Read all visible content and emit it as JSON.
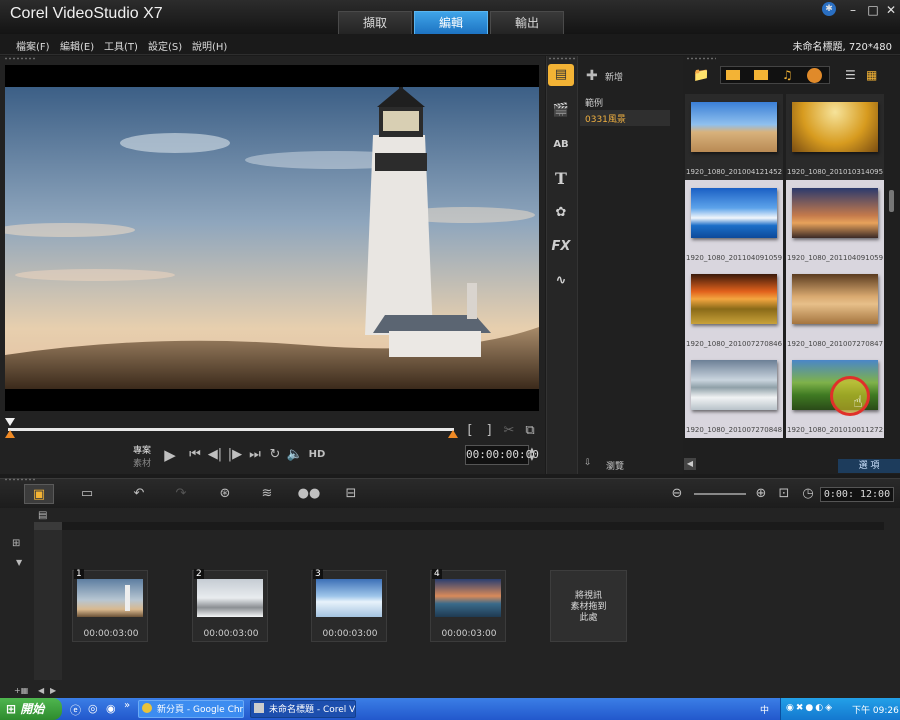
{
  "app": {
    "title": "Corel VideoStudio X7"
  },
  "workspace_tabs": [
    {
      "label": "擷取"
    },
    {
      "label": "編輯"
    },
    {
      "label": "輸出"
    }
  ],
  "menu": [
    "檔案(F)",
    "編輯(E)",
    "工具(T)",
    "設定(S)",
    "說明(H)"
  ],
  "project_info": "未命名標題, 720*480",
  "player": {
    "mode_labels": [
      "專案",
      "素材"
    ],
    "hd_label": "HD",
    "timecode": "00:00:00:00"
  },
  "library": {
    "add_label": "新增",
    "folders": [
      {
        "label": "範例"
      },
      {
        "label": "0331風景"
      }
    ],
    "browse_label": "瀏覽",
    "options_label": "選 項",
    "thumbnails": [
      {
        "caption": "1920_1080_20100412145258..."
      },
      {
        "caption": "1920_1080_20101031409515373..."
      },
      {
        "caption": "1920_1080_20110409105918299..."
      },
      {
        "caption": "1920_1080_20110409105919667..."
      },
      {
        "caption": "1920_1080_20100727084647113..."
      },
      {
        "caption": "1920_1080_20100727084736147..."
      },
      {
        "caption": "1920_1080_20100727084803177..."
      },
      {
        "caption": "1920_1080_20101001127247124..."
      }
    ]
  },
  "timeline": {
    "duration": "0:00: 12:00",
    "clips": [
      {
        "number": "1",
        "time": "00:00:03:00"
      },
      {
        "number": "2",
        "time": "00:00:03:00"
      },
      {
        "number": "3",
        "time": "00:00:03:00"
      },
      {
        "number": "4",
        "time": "00:00:03:00"
      }
    ],
    "drop_target": "將視訊\n素材拖到\n此處"
  },
  "taskbar": {
    "start_label": "開始",
    "tasks": [
      {
        "label": "新分頁 - Google Chro..."
      },
      {
        "label": "未命名標題 - Corel V..."
      }
    ],
    "clock": "下午 09:26"
  }
}
